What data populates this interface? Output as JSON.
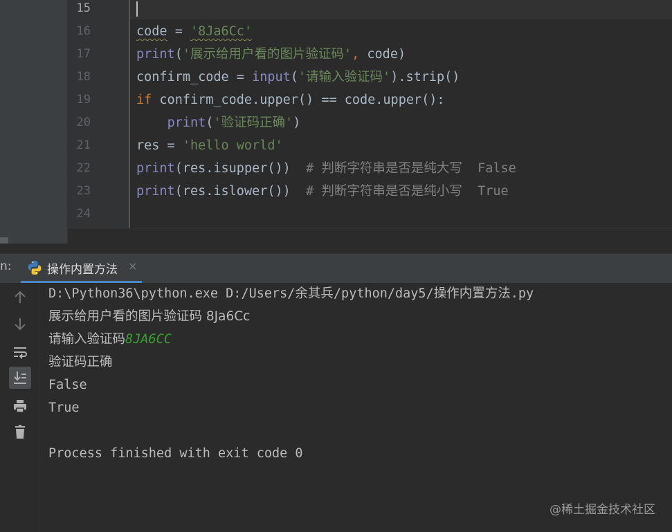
{
  "editor": {
    "line_numbers": [
      "15",
      "16",
      "17",
      "18",
      "19",
      "20",
      "21",
      "22",
      "23",
      "24"
    ],
    "lines": [
      {
        "text": ""
      },
      {
        "code": "code",
        "op": " = ",
        "str": "'8Ja6Cc'"
      },
      {
        "fn": "print",
        "open": "(",
        "str": "'展示给用户看的图片验证码'",
        "comma": ",",
        "rest": " code)"
      },
      {
        "pre": "confirm_code = ",
        "fn": "input",
        "open": "(",
        "str": "'请输入验证码'",
        "rest": ").strip()"
      },
      {
        "kw": "if",
        "rest": " confirm_code.upper() == code.upper():"
      },
      {
        "indent": "    ",
        "fn": "print",
        "open": "(",
        "str": "'验证码正确'",
        "rest": ")"
      },
      {
        "pre": "res = ",
        "str": "'hello world'"
      },
      {
        "fn": "print",
        "rest": "(res.isupper())",
        "comment": "  # 判断字符串是否是纯大写  False"
      },
      {
        "fn": "print",
        "rest": "(res.islower())",
        "comment": "  # 判断字符串是否是纯小写  True"
      },
      {
        "text": ""
      }
    ]
  },
  "run": {
    "label": "n:",
    "tab_title": "操作内置方法",
    "tab_close": "×",
    "toolbar": [
      "up-arrow-icon",
      "down-arrow-icon",
      "soft-wrap-icon",
      "scroll-to-end-icon",
      "print-icon",
      "trash-icon"
    ],
    "console": {
      "command": "D:\\Python36\\python.exe D:/Users/余其兵/python/day5/操作内置方法.py",
      "output1": "展示给用户看的图片验证码 8Ja6Cc",
      "prompt": "请输入验证码",
      "user_input": "8JA6CC",
      "output2": "验证码正确",
      "output3": "False",
      "output4": "True",
      "finish": "Process finished with exit code 0"
    }
  },
  "watermark": "@稀土掘金技术社区",
  "colors": {
    "background": "#2b2b2b",
    "string": "#6a8759",
    "builtin": "#8888c6",
    "keyword": "#cc7832",
    "comment": "#808080",
    "user_input": "#399f2f",
    "tab_underline": "#4a88c7"
  }
}
